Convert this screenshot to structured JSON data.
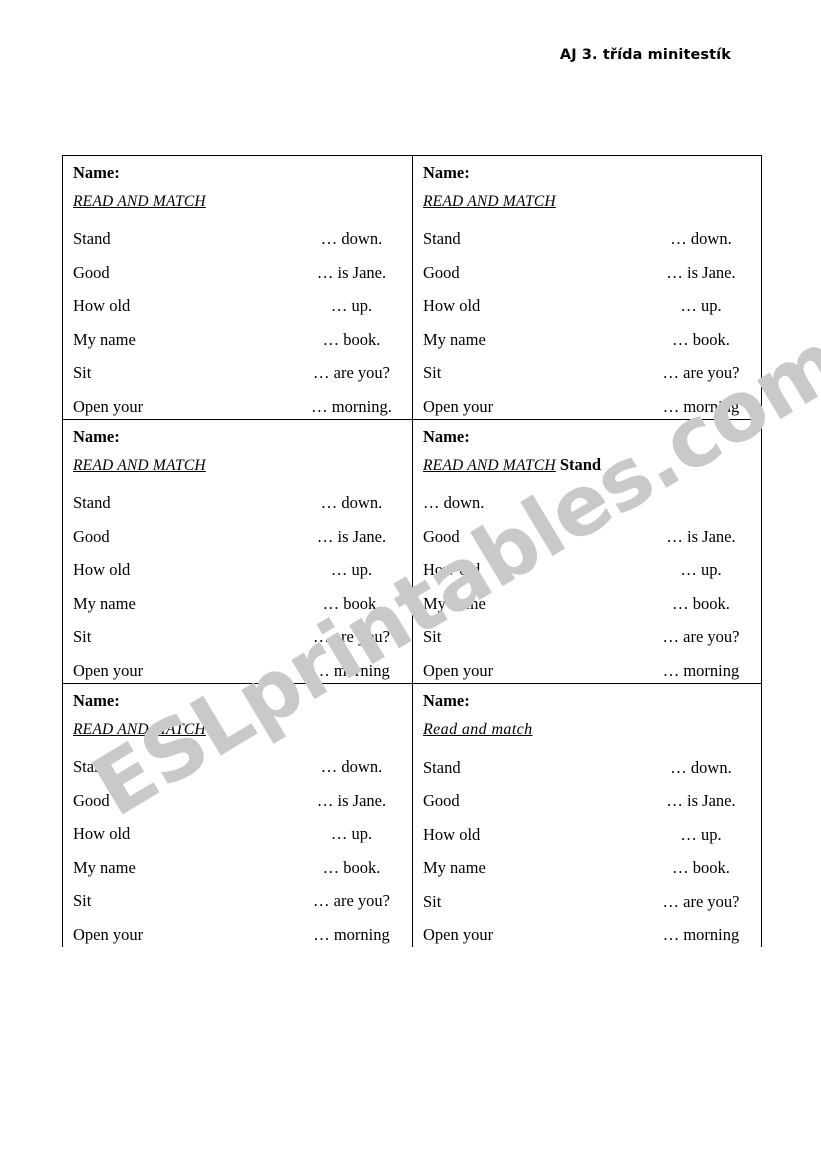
{
  "page": {
    "header_title": "AJ 3. třída minitestík",
    "watermark_text": "ESLprintables.com",
    "watermark_color": "#c9c9c9",
    "text_color": "#000000",
    "border_color": "#000000"
  },
  "labels": {
    "name": "Name:"
  },
  "prompts": {
    "stand": "Stand",
    "good": "Good",
    "how_old": "How old",
    "my_name": "My name",
    "sit": "Sit",
    "open_your": "Open your"
  },
  "answers": {
    "down_period": "… down.",
    "is_jane": "… is Jane.",
    "up": "… up.",
    "book": "… book.",
    "are_you": "… are you?",
    "morning_period": "… morning.",
    "morning_no_period": "… morning"
  },
  "cells": [
    {
      "id": "cell-1-top-left",
      "name_label": "Name:",
      "instruction": "READ AND MATCH",
      "instruction_style": "smallcaps",
      "trailing_word": "",
      "orphan_answer": "",
      "rows": [
        {
          "left": "Stand",
          "right": "… down."
        },
        {
          "left": "Good",
          "right": "… is Jane."
        },
        {
          "left": "How old",
          "right": "… up."
        },
        {
          "left": "My name",
          "right": "… book."
        },
        {
          "left": "Sit",
          "right": "… are you?"
        },
        {
          "left": "Open your",
          "right": "… morning."
        }
      ]
    },
    {
      "id": "cell-2-top-right",
      "name_label": "Name:",
      "instruction": "READ AND MATCH",
      "instruction_style": "smallcaps",
      "trailing_word": "",
      "orphan_answer": "",
      "rows": [
        {
          "left": "Stand",
          "right": "… down."
        },
        {
          "left": "Good",
          "right": "… is Jane."
        },
        {
          "left": "How old",
          "right": "… up."
        },
        {
          "left": "My name",
          "right": "… book."
        },
        {
          "left": "Sit",
          "right": "… are you?"
        },
        {
          "left": "Open your",
          "right": "… morning"
        }
      ]
    },
    {
      "id": "cell-3-middle-left",
      "name_label": "Name:",
      "instruction": "READ AND MATCH",
      "instruction_style": "smallcaps",
      "trailing_word": "",
      "orphan_answer": "",
      "rows": [
        {
          "left": "Stand",
          "right": "… down."
        },
        {
          "left": "Good",
          "right": "… is Jane."
        },
        {
          "left": "How old",
          "right": "… up."
        },
        {
          "left": "My name",
          "right": "… book."
        },
        {
          "left": "Sit",
          "right": "… are you?"
        },
        {
          "left": "Open your",
          "right": "… morning"
        }
      ]
    },
    {
      "id": "cell-4-middle-right",
      "name_label": "Name:",
      "instruction": "READ AND MATCH",
      "instruction_style": "smallcaps",
      "trailing_word": "Stand",
      "orphan_answer": "… down.",
      "rows": [
        {
          "left": "Good",
          "right": "… is Jane."
        },
        {
          "left": "How old",
          "right": "… up."
        },
        {
          "left": "My name",
          "right": "… book."
        },
        {
          "left": "Sit",
          "right": "… are you?"
        },
        {
          "left": "Open your",
          "right": "… morning"
        }
      ]
    },
    {
      "id": "cell-5-bottom-left",
      "name_label": "Name:",
      "instruction": "READ AND MATCH",
      "instruction_style": "smallcaps",
      "trailing_word": "",
      "orphan_answer": "",
      "rows": [
        {
          "left": "Stand",
          "right": "… down."
        },
        {
          "left": "Good",
          "right": "… is Jane."
        },
        {
          "left": "How old",
          "right": "… up."
        },
        {
          "left": "My name",
          "right": "… book."
        },
        {
          "left": "Sit",
          "right": "… are you?"
        },
        {
          "left": "Open your",
          "right": "… morning"
        }
      ]
    },
    {
      "id": "cell-6-bottom-right",
      "name_label": "Name:",
      "instruction": "Read and match",
      "instruction_style": "mixedcase",
      "trailing_word": "",
      "orphan_answer": "",
      "rows": [
        {
          "left": "Stand",
          "right": "… down."
        },
        {
          "left": "Good",
          "right": "… is Jane."
        },
        {
          "left": "How old",
          "right": "… up."
        },
        {
          "left": "My name",
          "right": "… book."
        },
        {
          "left": "Sit",
          "right": "… are you?"
        },
        {
          "left": "Open your",
          "right": "… morning"
        }
      ]
    }
  ]
}
